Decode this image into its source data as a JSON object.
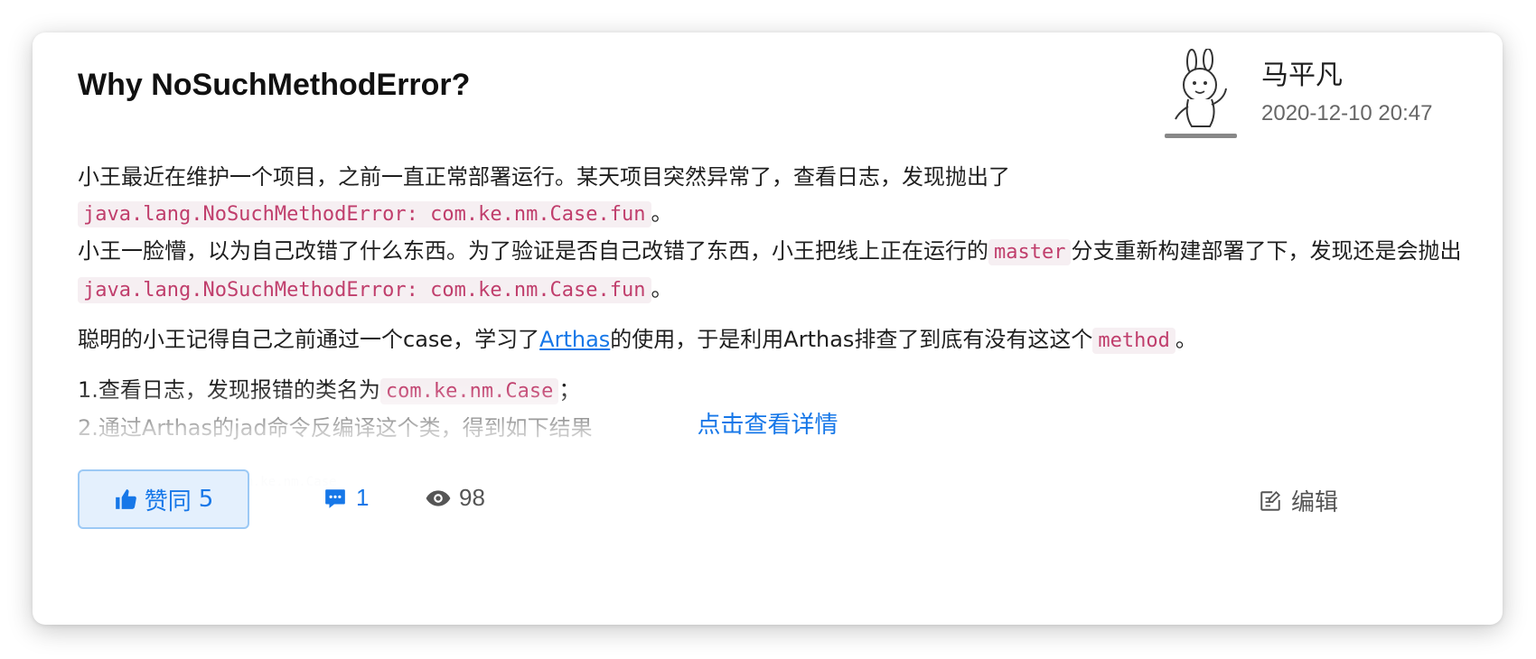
{
  "post": {
    "title": "Why NoSuchMethodError?",
    "author": "马平凡",
    "date": "2020-12-10 20:47",
    "avatar_icon": "bunny-sticker-avatar"
  },
  "content": {
    "p1_text1": "小王最近在维护一个项目，之前一直正常部署运行。某天项目突然异常了，查看日志，发现抛出了",
    "p1_code1": "java.lang.NoSuchMethodError: com.ke.nm.Case.fun",
    "p1_text2": "。",
    "p2_text1": "小王一脸懵，以为自己改错了什么东西。为了验证是否自己改错了东西，小王把线上正在运行的",
    "p2_code1": "master",
    "p2_text2": "分支重新构建部署了下，发现还是会抛出",
    "p2_code2": "java.lang.NoSuchMethodError: com.ke.nm.Case.fun",
    "p2_text3": "。",
    "p3_text1": "聪明的小王记得自己之前通过一个case，学习了",
    "p3_link": "Arthas",
    "p3_text2": "的使用，于是利用Arthas排查了到底有没有这这个",
    "p3_code1": "method",
    "p3_text3": "。",
    "step1_text": "1.查看日志，发现报错的类名为",
    "step1_code": "com.ke.nm.Case",
    "step1_end": "；",
    "step2_text": "2.通过Arthas的jad命令反编译这个类，得到如下结果",
    "codeblock_line": "[arthas@15686]$ jad com.ke.nm.Case"
  },
  "read_more_label": "点击查看详情",
  "actions": {
    "like_label": "赞同",
    "like_count": "5",
    "comment_count": "1",
    "view_count": "98",
    "edit_label": "编辑"
  },
  "colors": {
    "accent": "#1677e8",
    "code_text": "#c03e6c",
    "code_bg": "#f6eff2",
    "like_bg": "#e4f0fd"
  }
}
